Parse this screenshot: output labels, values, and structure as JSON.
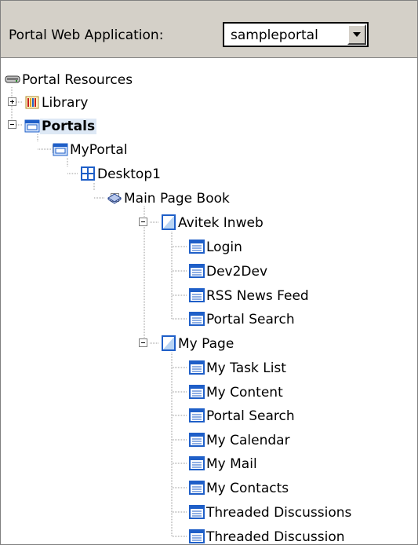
{
  "header": {
    "label": "Portal Web Application:",
    "select_value": "sampleportal"
  },
  "tree": {
    "root": "Portal Resources",
    "library": "Library",
    "portals": "Portals",
    "myportal": "MyPortal",
    "desktop": "Desktop1",
    "book": "Main Page Book",
    "page1": {
      "label": "Avitek Inweb",
      "portlets": [
        "Login",
        "Dev2Dev",
        "RSS News Feed",
        "Portal Search"
      ]
    },
    "page2": {
      "label": "My Page",
      "portlets": [
        "My Task List",
        "My Content",
        "Portal Search",
        "My Calendar",
        "My Mail",
        "My Contacts",
        "Threaded Discussions",
        "Threaded Discussion"
      ]
    }
  },
  "colors": {
    "selection": "#dde8f5",
    "toolbar": "#d4d0c8",
    "icon_blue": "#1f5fc8"
  }
}
